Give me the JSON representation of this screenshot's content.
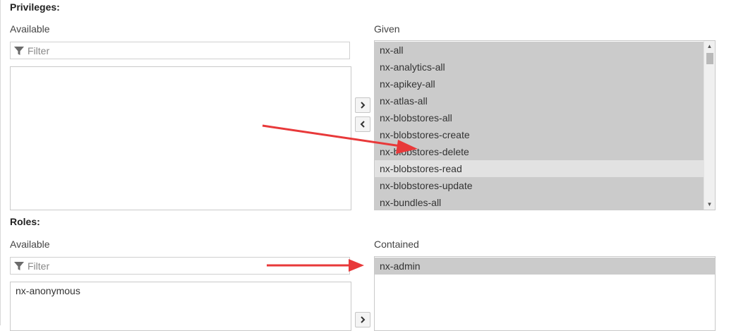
{
  "privileges": {
    "heading": "Privileges:",
    "available": {
      "label": "Available",
      "filter_placeholder": "Filter",
      "items": []
    },
    "given": {
      "label": "Given",
      "items": [
        "nx-all",
        "nx-analytics-all",
        "nx-apikey-all",
        "nx-atlas-all",
        "nx-blobstores-all",
        "nx-blobstores-create",
        "nx-blobstores-delete",
        "nx-blobstores-read",
        "nx-blobstores-update",
        "nx-bundles-all"
      ]
    }
  },
  "roles": {
    "heading": "Roles:",
    "available": {
      "label": "Available",
      "filter_placeholder": "Filter",
      "items": [
        "nx-anonymous"
      ]
    },
    "contained": {
      "label": "Contained",
      "items": [
        "nx-admin"
      ]
    }
  },
  "icons": {
    "filter": "filter-icon",
    "move_right": "chevron-right-icon",
    "move_left": "chevron-left-icon",
    "scroll_up": "scroll-up-icon",
    "scroll_down": "scroll-down-icon"
  },
  "colors": {
    "selected_item": "#cbcbcb",
    "hover_item": "#e2e2e2",
    "annotation_arrow": "#e8393a"
  }
}
